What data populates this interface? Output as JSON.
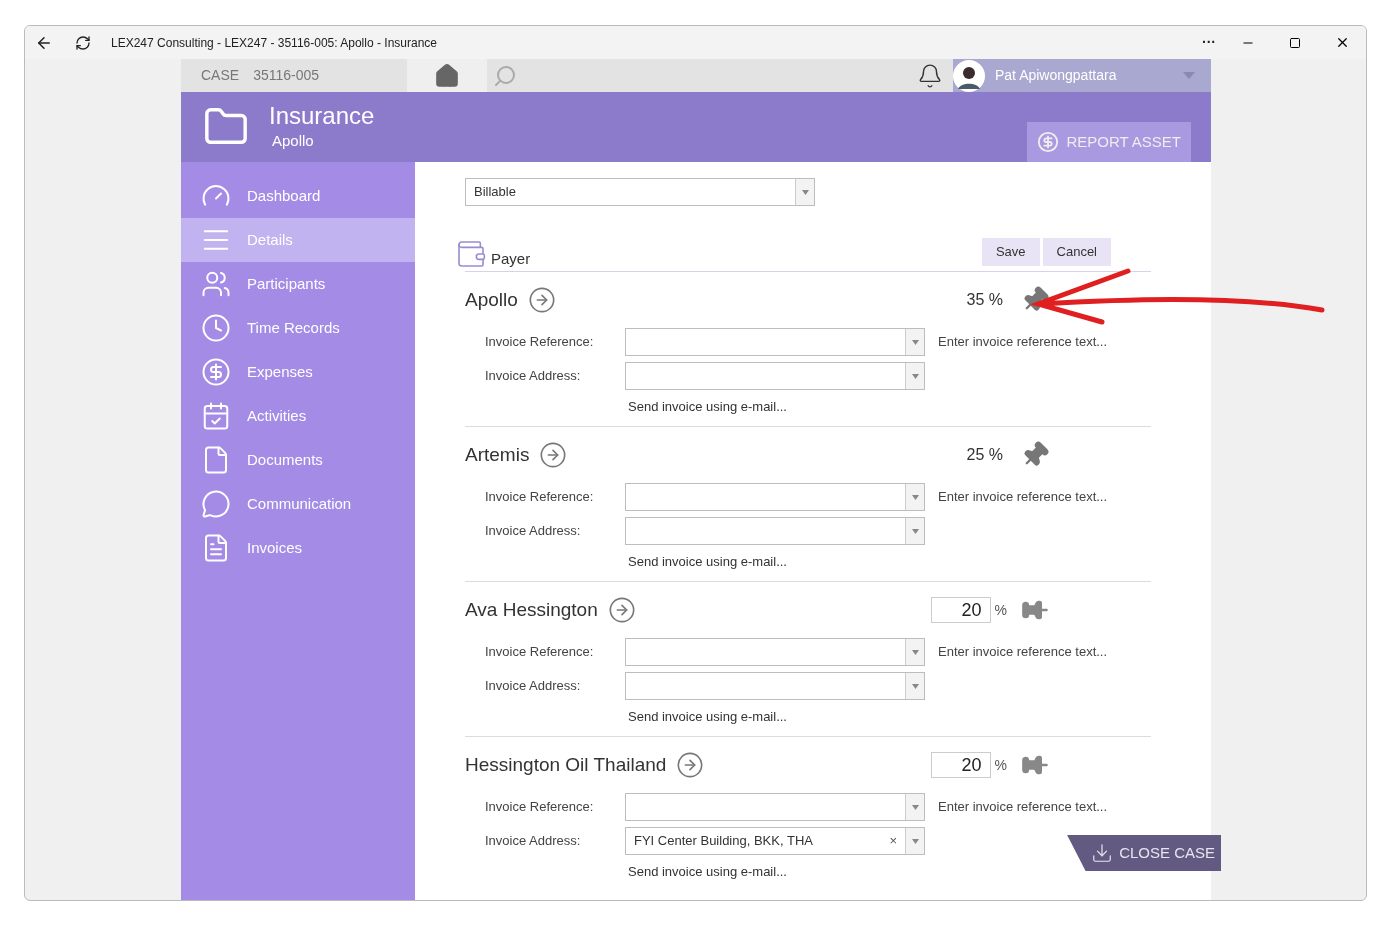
{
  "window": {
    "title": "LEX247 Consulting - LEX247 - 35116-005: Apollo - Insurance",
    "menu": "···"
  },
  "top_bar": {
    "case_label": "CASE",
    "case_number": "35116-005",
    "user": "Pat Apiwongpattara"
  },
  "header": {
    "title": "Insurance",
    "subtitle": "Apollo",
    "report_button": "REPORT ASSET"
  },
  "sidebar": {
    "items": [
      {
        "label": "Dashboard",
        "selected": false
      },
      {
        "label": "Details",
        "selected": true
      },
      {
        "label": "Participants",
        "selected": false
      },
      {
        "label": "Time Records",
        "selected": false
      },
      {
        "label": "Expenses",
        "selected": false
      },
      {
        "label": "Activities",
        "selected": false
      },
      {
        "label": "Documents",
        "selected": false
      },
      {
        "label": "Communication",
        "selected": false
      },
      {
        "label": "Invoices",
        "selected": false
      }
    ]
  },
  "billing": {
    "value": "Billable"
  },
  "payer_section": {
    "title": "Payer",
    "save": "Save",
    "cancel": "Cancel",
    "payers": [
      {
        "name": "Apollo",
        "pinned": true,
        "percent": "35 %",
        "reference_label": "Invoice Reference:",
        "reference_hint": "Enter invoice reference text...",
        "address_label": "Invoice Address:",
        "email_link": "Send invoice using e-mail..."
      },
      {
        "name": "Artemis",
        "pinned": true,
        "percent": "25 %",
        "reference_label": "Invoice Reference:",
        "reference_hint": "Enter invoice reference text...",
        "address_label": "Invoice Address:",
        "email_link": "Send invoice using e-mail..."
      },
      {
        "name": "Ava Hessington",
        "pinned": false,
        "percent": "20",
        "unit": "%",
        "reference_label": "Invoice Reference:",
        "reference_hint": "Enter invoice reference text...",
        "address_label": "Invoice Address:",
        "email_link": "Send invoice using e-mail..."
      },
      {
        "name": "Hessington Oil Thailand",
        "pinned": false,
        "percent": "20",
        "unit": "%",
        "reference_label": "Invoice Reference:",
        "reference_hint": "Enter invoice reference text...",
        "address_label": "Invoice Address:",
        "address_value": "FYI Center Building, BKK, THA",
        "address_clear": "×",
        "email_link": "Send invoice using e-mail..."
      }
    ]
  },
  "close_case": "CLOSE CASE"
}
